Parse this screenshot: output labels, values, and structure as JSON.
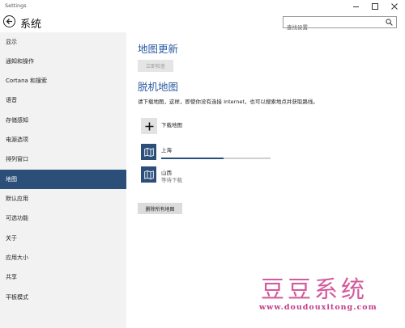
{
  "window": {
    "title": "Settings"
  },
  "header": {
    "title": "系统",
    "search_placeholder": "查找设置"
  },
  "sidebar": {
    "items": [
      {
        "label": "显示",
        "active": false
      },
      {
        "label": "通知和操作",
        "active": false
      },
      {
        "label": "Cortana 和搜索",
        "active": false
      },
      {
        "label": "语音",
        "active": false
      },
      {
        "label": "存储感知",
        "active": false
      },
      {
        "label": "电源选项",
        "active": false
      },
      {
        "label": "排列窗口",
        "active": false
      },
      {
        "label": "地图",
        "active": true
      },
      {
        "label": "默认应用",
        "active": false
      },
      {
        "label": "可选功能",
        "active": false
      },
      {
        "label": "关于",
        "active": false
      },
      {
        "label": "应用大小",
        "active": false
      },
      {
        "label": "共享",
        "active": false
      },
      {
        "label": "平板模式",
        "active": false
      }
    ]
  },
  "main": {
    "update_heading": "地图更新",
    "check_button": "立即检查",
    "offline_heading": "脱机地图",
    "description": "请下载地图，这样，即使你没有连接 Internet，也可以搜索地点并获取路线。",
    "add_label": "下载地图",
    "maps": [
      {
        "name": "上海",
        "status": "",
        "progress": 0.57
      },
      {
        "name": "山西",
        "status": "等待下载"
      }
    ],
    "delete_button": "删除所有地图"
  },
  "watermark": {
    "title": "豆豆系统",
    "url": "www.doudouxitong.com"
  },
  "colors": {
    "accent": "#2c4f7a",
    "heading": "#2b5aa3",
    "sidebar_bg": "#f2f2f2",
    "watermark": "#d35a9c"
  }
}
